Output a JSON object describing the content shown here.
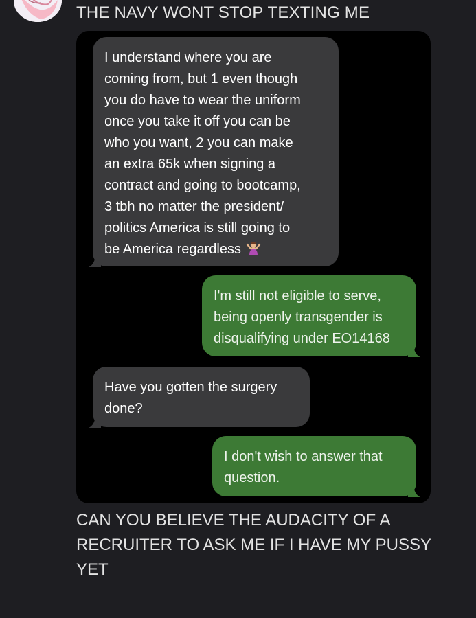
{
  "post": {
    "title": "THE NAVY WONT STOP TEXTING ME",
    "caption_lines": [
      "CAN YOU BELIEVE THE AUDACITY OF A",
      "RECRUITER TO ASK ME IF I HAVE MY PUSSY",
      "YET"
    ]
  },
  "messages": [
    {
      "direction": "incoming",
      "lines": [
        "I understand where you are",
        "coming from, but 1 even though",
        "you do have to wear the uniform",
        "once you take it off you can be",
        "who you want, 2 you can make",
        "an extra 65k when signing a",
        "contract and going to bootcamp,",
        "3 tbh no matter the president/",
        "politics America is still going to",
        "be America regardless"
      ],
      "trailing_icon": "person-shrugging-emoji"
    },
    {
      "direction": "outgoing",
      "lines": [
        "I'm still not eligible to serve,",
        "being openly transgender is",
        "disqualifying under EO14168"
      ]
    },
    {
      "direction": "incoming",
      "lines": [
        "Have you gotten the surgery",
        "done?"
      ]
    },
    {
      "direction": "outgoing",
      "lines": [
        "I don't wish to answer that",
        "question."
      ]
    }
  ],
  "colors": {
    "page_background": "#1e1e22",
    "screenshot_background": "#000000",
    "incoming_bubble": "#3a3a3c",
    "outgoing_bubble": "#3d7a35"
  }
}
